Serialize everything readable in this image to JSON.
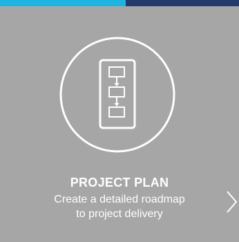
{
  "colors": {
    "accent_cyan": "#1fb3e2",
    "accent_navy": "#233a6b",
    "card_background": "#a6a6a6",
    "foreground": "#ffffff"
  },
  "card": {
    "icon": "flowchart-icon",
    "title": "PROJECT PLAN",
    "description_line1": "Create a detailed roadmap",
    "description_line2": "to project delivery",
    "next_icon": "chevron-right-icon"
  }
}
